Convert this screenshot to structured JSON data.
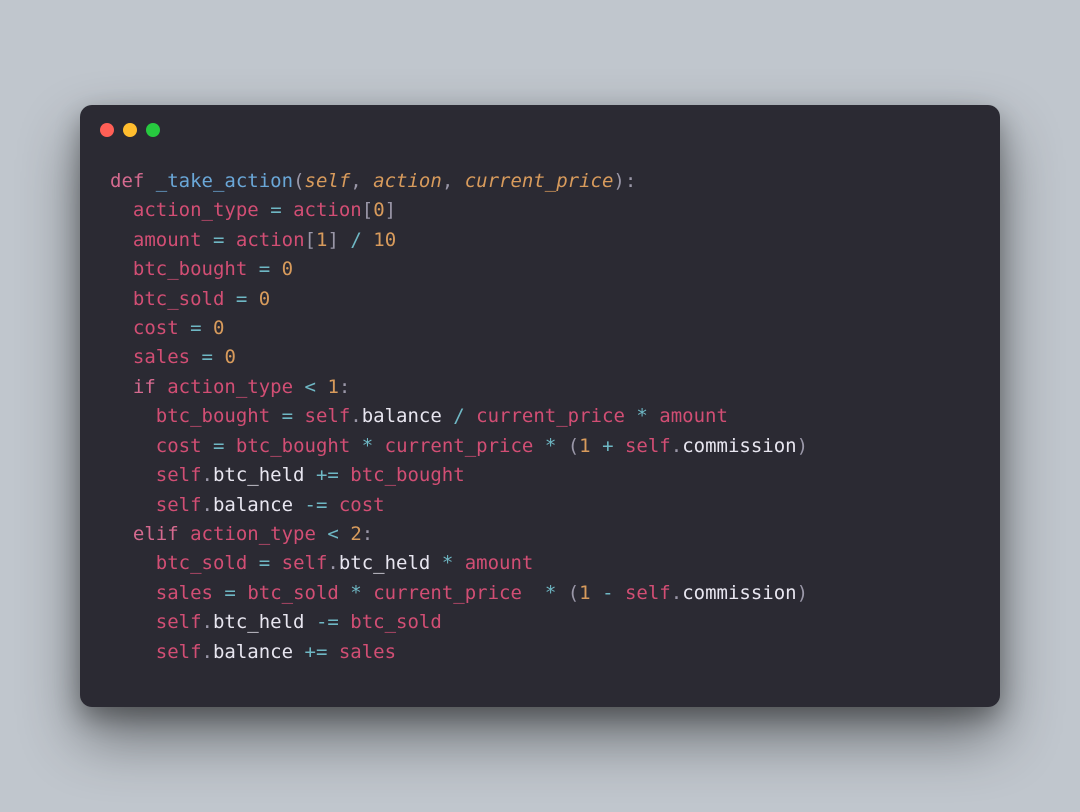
{
  "code": {
    "t00": "def",
    "t01": "_take_action",
    "t02": "self",
    "t03": "action",
    "t04": "current_price",
    "t05": "action_type",
    "t06": "action",
    "t07": "0",
    "t08": "amount",
    "t09": "action",
    "t10": "1",
    "t11": "10",
    "t12": "btc_bought",
    "t13": "0",
    "t14": "btc_sold",
    "t15": "0",
    "t16": "cost",
    "t17": "0",
    "t18": "sales",
    "t19": "0",
    "t20": "if",
    "t21": "action_type",
    "t22": "1",
    "t23": "btc_bought",
    "t24": "self",
    "t25": "balance",
    "t26": "current_price",
    "t27": "amount",
    "t28": "cost",
    "t29": "btc_bought",
    "t30": "current_price",
    "t31": "1",
    "t32": "self",
    "t33": "commission",
    "t34": "self",
    "t35": "btc_held",
    "t36": "btc_bought",
    "t37": "self",
    "t38": "balance",
    "t39": "cost",
    "t40": "elif",
    "t41": "action_type",
    "t42": "2",
    "t43": "btc_sold",
    "t44": "self",
    "t45": "btc_held",
    "t46": "amount",
    "t47": "sales",
    "t48": "btc_sold",
    "t49": "current_price",
    "t50": "1",
    "t51": "self",
    "t52": "commission",
    "t53": "self",
    "t54": "btc_held",
    "t55": "btc_sold",
    "t56": "self",
    "t57": "balance",
    "t58": "sales"
  }
}
